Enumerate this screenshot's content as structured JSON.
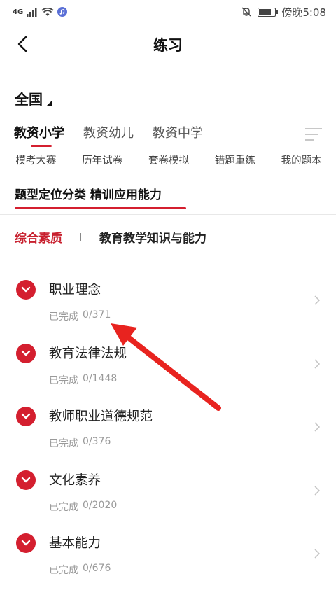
{
  "status_bar": {
    "network": "4G",
    "time": "傍晚5:08",
    "battery_level": 0.8
  },
  "header": {
    "title": "练习",
    "back_icon": "chevron-left-icon"
  },
  "region": {
    "label": "全国"
  },
  "main_tabs": [
    {
      "label": "教资小学",
      "active": true
    },
    {
      "label": "教资幼儿",
      "active": false
    },
    {
      "label": "教资中学",
      "active": false
    }
  ],
  "sub_tabs": [
    "模考大赛",
    "历年试卷",
    "套卷模拟",
    "错题重练",
    "我的题本"
  ],
  "banner": {
    "text": "题型定位分类 精训应用能力"
  },
  "category_tabs": [
    {
      "label": "综合素质",
      "active": true
    },
    {
      "label": "教育教学知识与能力",
      "active": false
    }
  ],
  "subjects": [
    {
      "name": "职业理念",
      "progress_label": "已完成",
      "progress": "0/371"
    },
    {
      "name": "教育法律法规",
      "progress_label": "已完成",
      "progress": "0/1448"
    },
    {
      "name": "教师职业道德规范",
      "progress_label": "已完成",
      "progress": "0/376"
    },
    {
      "name": "文化素养",
      "progress_label": "已完成",
      "progress": "0/2020"
    },
    {
      "name": "基本能力",
      "progress_label": "已完成",
      "progress": "0/676"
    }
  ],
  "colors": {
    "accent": "#d41f2f",
    "arrow": "#e8231f"
  }
}
